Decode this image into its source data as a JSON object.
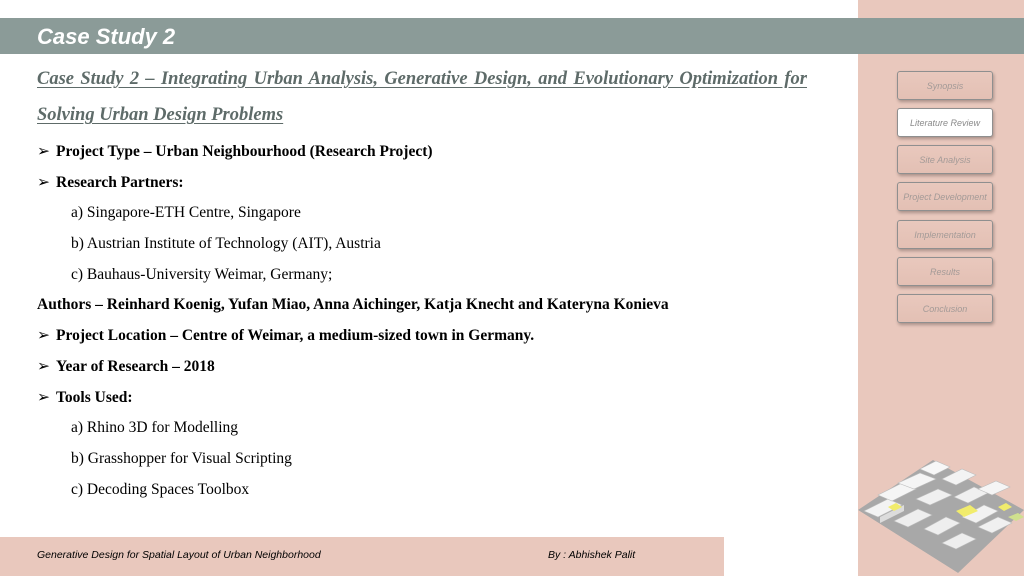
{
  "header": {
    "title": "Case Study 2"
  },
  "case_heading": "Case Study 2 – Integrating Urban Analysis, Generative Design, and Evolutionary Optimization for Solving Urban Design Problems",
  "project_type": "Project Type – Urban Neighbourhood (Research Project)",
  "research_partners": {
    "label": "Research Partners:",
    "items": [
      "a) Singapore-ETH Centre, Singapore",
      "b) Austrian Institute of Technology (AIT), Austria",
      "c) Bauhaus-University Weimar, Germany;"
    ]
  },
  "authors": "Authors – Reinhard Koenig, Yufan Miao, Anna Aichinger, Katja Knecht and Kateryna Konieva",
  "project_location": "Project Location – Centre of Weimar, a medium-sized town in Germany.",
  "year_of_research": "Year of Research – 2018",
  "tools": {
    "label": "Tools Used:",
    "items": [
      "a) Rhino 3D for Modelling",
      "b) Grasshopper for Visual Scripting",
      "c) Decoding Spaces Toolbox"
    ]
  },
  "nav": {
    "items": [
      {
        "label": "Synopsis"
      },
      {
        "label": "Literature Review",
        "active": true
      },
      {
        "label": "Site Analysis"
      },
      {
        "label": "Project Development"
      },
      {
        "label": "Implementation"
      },
      {
        "label": "Results"
      },
      {
        "label": "Conclusion"
      }
    ]
  },
  "footer": {
    "title": "Generative Design for Spatial Layout of Urban Neighborhood",
    "author": "By : Abhishek Palit"
  },
  "colors": {
    "header_bar": "#8b9b98",
    "side_panel": "#e9c8bd",
    "heading_text": "#5e6b69"
  }
}
